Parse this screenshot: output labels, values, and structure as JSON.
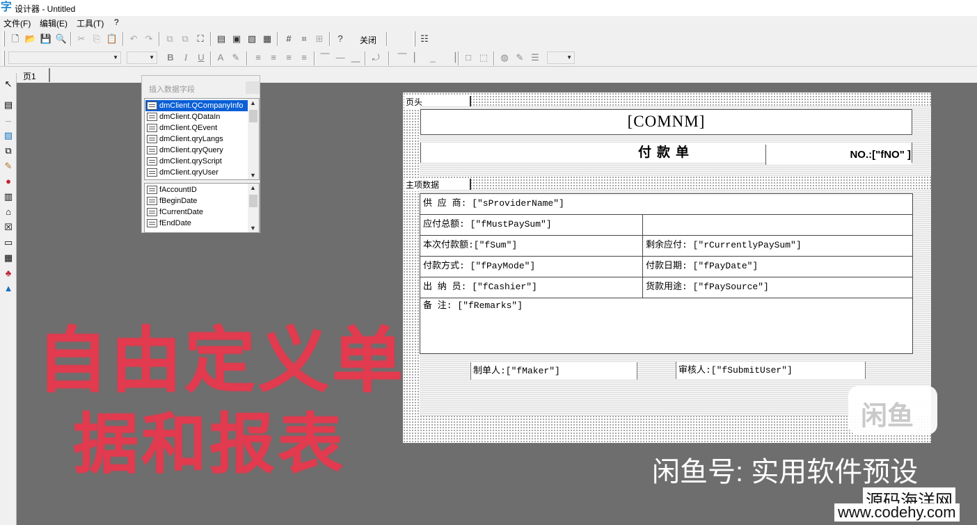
{
  "window": {
    "title": "设计器 - Untitled"
  },
  "menu": [
    "文件(F)",
    "编辑(E)",
    "工具(T)",
    "?"
  ],
  "toolbar": {
    "close_label": "关闭"
  },
  "tabs": [
    "页1"
  ],
  "field_panel": {
    "title": "插入数据字段",
    "datasets": [
      "dmClient.QCompanyInfo",
      "dmClient.QDataIn",
      "dmClient.QEvent",
      "dmClient.qryLangs",
      "dmClient.qryQuery",
      "dmClient.qryScript",
      "dmClient.qryUser"
    ],
    "selected_dataset": "dmClient.QCompanyInfo",
    "fields": [
      "fAccountID",
      "fBeginDate",
      "fCurrentDate",
      "fEndDate"
    ]
  },
  "report": {
    "page_header_label": "页头",
    "master_band_label": "主项数据",
    "company": "[COMNM]",
    "doc_title": "付款单",
    "doc_no": "NO.:[\"fNO\" ]",
    "rows": {
      "supplier": "供 应 商:  [\"sProviderName\"]",
      "must_pay": "应付总额:  [\"fMustPaySum\"]",
      "this_pay": "本次付款额:[\"fSum\"]",
      "remaining": "剩余应付:  [\"rCurrentlyPaySum\"]",
      "pay_mode": "付款方式:  [\"fPayMode\"]",
      "pay_date": "付款日期:  [\"fPayDate\"]",
      "cashier": "出 纳 员:  [\"fCashier\"]",
      "pay_source": "货款用途:  [\"fPaySource\"]",
      "remarks": "备    注:  [\"fRemarks\"]"
    },
    "maker": "制单人:[\"fMaker\"]",
    "auditor": "审核人:[\"fSubmitUser\"]"
  },
  "overlay": {
    "line1": "自由定义单",
    "line2": "据和报表",
    "badge": "闲鱼",
    "watermark": "闲鱼号: 实用软件预设",
    "site_name": "源码海洋网",
    "site_url": "www.codehy.com"
  }
}
